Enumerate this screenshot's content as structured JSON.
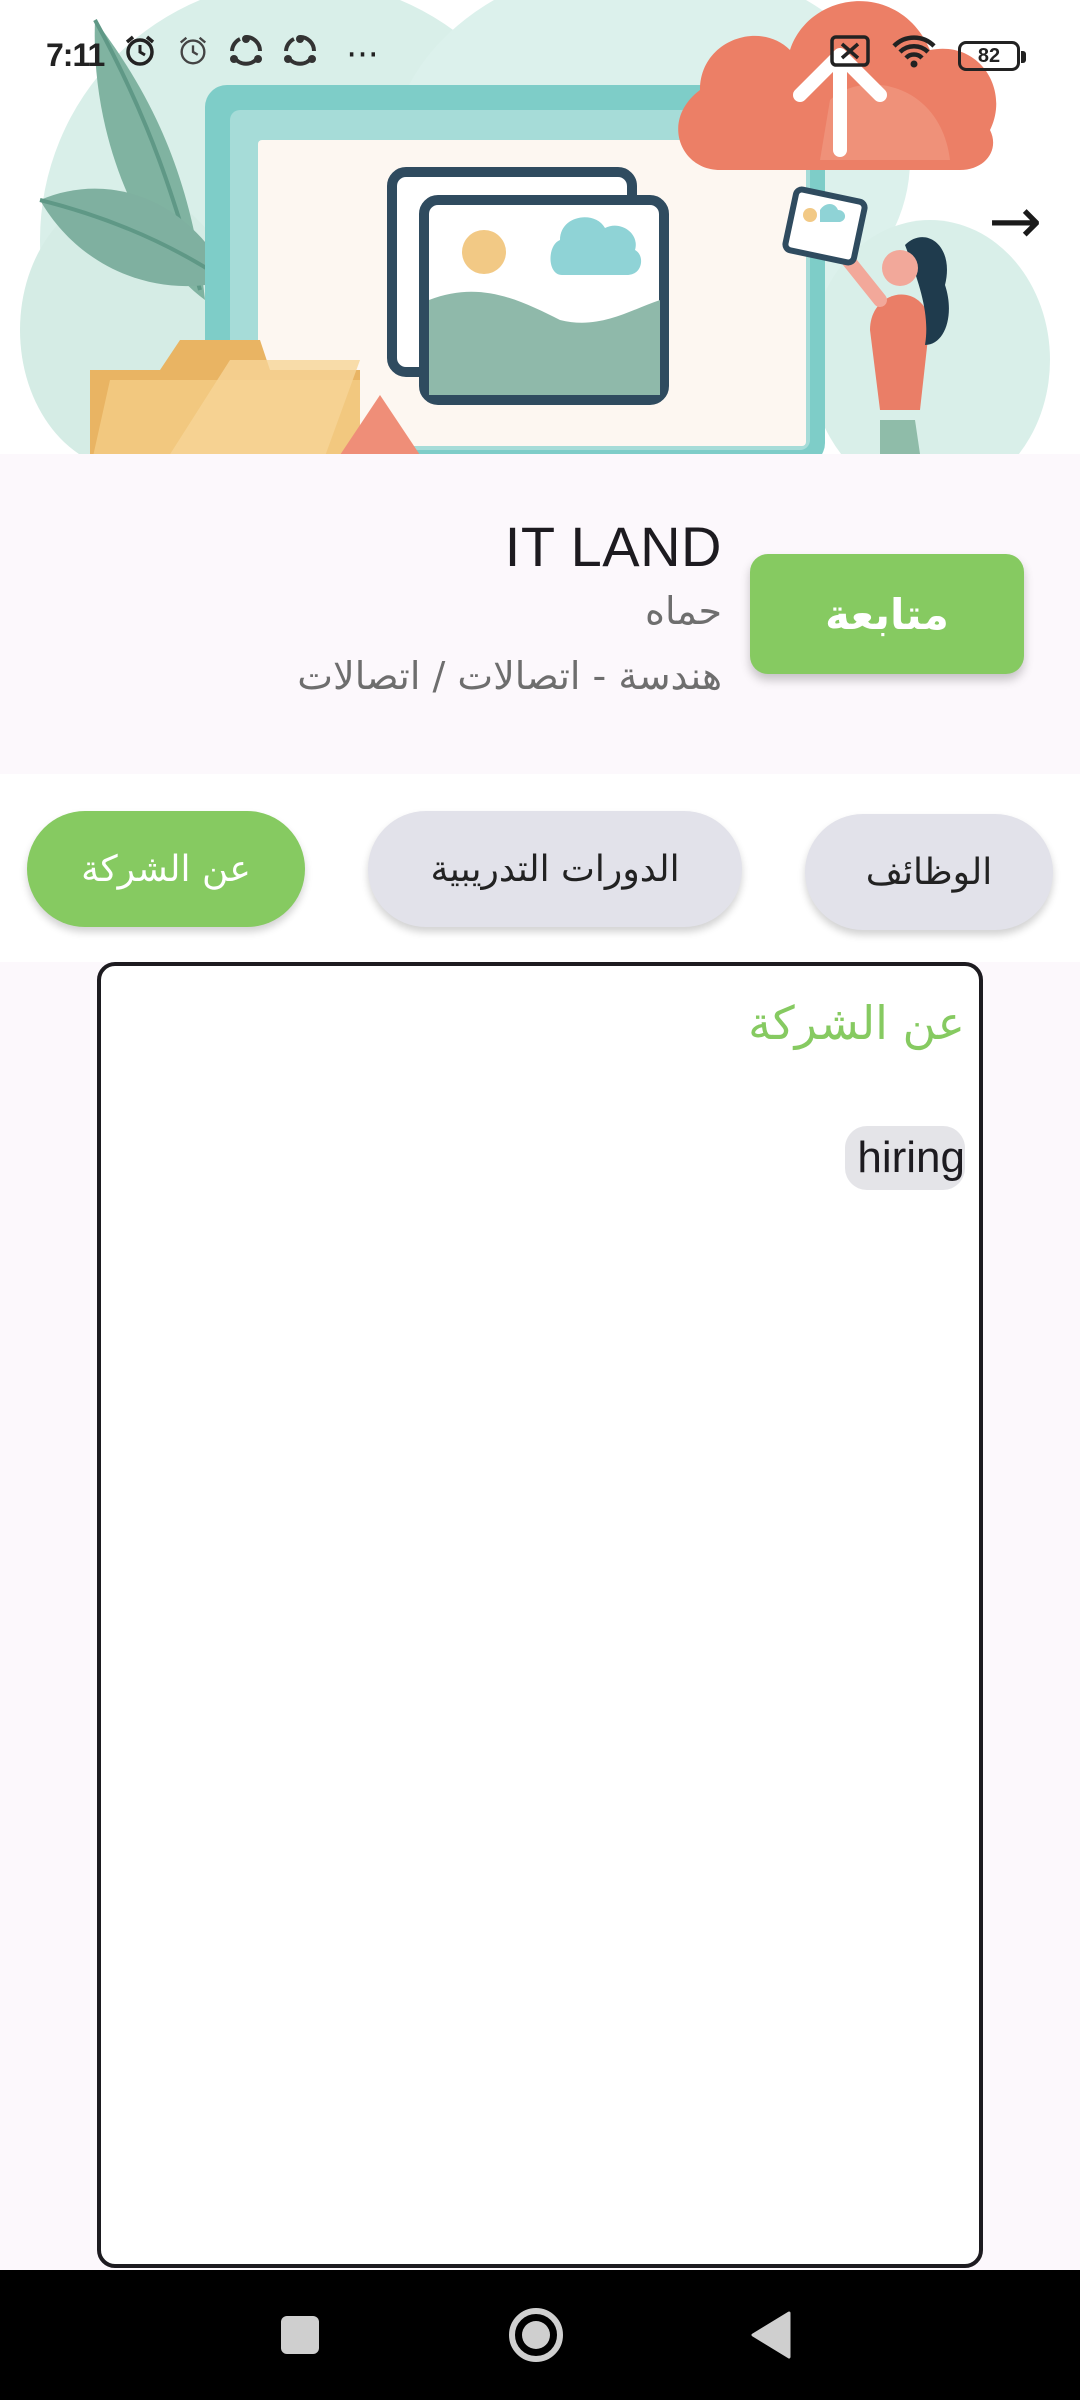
{
  "status_bar": {
    "time": "7:11",
    "battery_level": "82",
    "icons": [
      "alarm-icon",
      "alarm-icon",
      "share-app-icon",
      "share-app-icon",
      "more-dots-icon",
      "sim-blocked-icon",
      "wifi-icon",
      "battery-icon"
    ],
    "overflow_label": "···"
  },
  "header": {
    "banner_illustration": "cloud-upload-illustration",
    "next_arrow": "→"
  },
  "company": {
    "name": "IT LAND",
    "city": "حماه",
    "field": "هندسة - اتصالات / اتصالات",
    "follow_label": "متابعة"
  },
  "tabs": [
    {
      "label": "الوظائف",
      "active": false
    },
    {
      "label": "الدورات التدريبية",
      "active": false
    },
    {
      "label": "عن الشركة",
      "active": true
    }
  ],
  "about": {
    "title": "عن الشركة",
    "tag": "hiring"
  },
  "colors": {
    "accent_green": "#86ca61",
    "inactive_tab": "#e2e2ea",
    "background": "#fcf8fc"
  },
  "nav_bar": {
    "buttons": [
      "recents-icon",
      "home-icon",
      "back-icon"
    ]
  }
}
